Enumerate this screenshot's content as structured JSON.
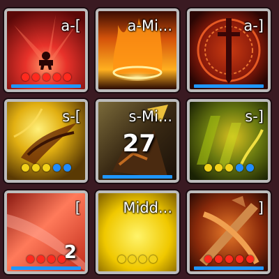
{
  "colors": {
    "pip_red": "#ff2a1e",
    "pip_yellow": "#f2d21a",
    "pip_blue": "#1f8cff",
    "bar": "#1f97ff",
    "border": "#bcbcbc"
  },
  "slots": [
    {
      "label": "a-[",
      "icon": "red-figure-burst-icon",
      "count": "",
      "pips": [
        "red",
        "red",
        "red",
        "red",
        "red"
      ]
    },
    {
      "label": "a-Mi...",
      "icon": "flame-pillar-icon",
      "count": "",
      "pips": []
    },
    {
      "label": "a-]",
      "icon": "sword-rune-circle-icon",
      "count": "",
      "pips": []
    },
    {
      "label": "s-[",
      "icon": "golden-wing-slash-icon",
      "count": "",
      "pips": [
        "yellow",
        "yellow",
        "yellow",
        "blue",
        "blue"
      ]
    },
    {
      "label": "s-Mi...",
      "icon": "dark-warrior-icon",
      "count": "27",
      "pips": []
    },
    {
      "label": "s-]",
      "icon": "green-vortex-icon",
      "count": "",
      "pips": [
        "yellow",
        "yellow",
        "yellow",
        "blue",
        "blue"
      ]
    },
    {
      "label": "[",
      "icon": "red-slash-icon",
      "count": "2",
      "pips": [
        "red",
        "red",
        "red",
        "red"
      ]
    },
    {
      "label": "Midd...",
      "icon": "yellow-glow-icon",
      "count": "",
      "pips": [
        "yellow",
        "yellow",
        "yellow",
        "yellow"
      ]
    },
    {
      "label": "]",
      "icon": "crossed-blades-icon",
      "count": "",
      "pips": [
        "red",
        "red",
        "red",
        "red",
        "red"
      ]
    }
  ]
}
